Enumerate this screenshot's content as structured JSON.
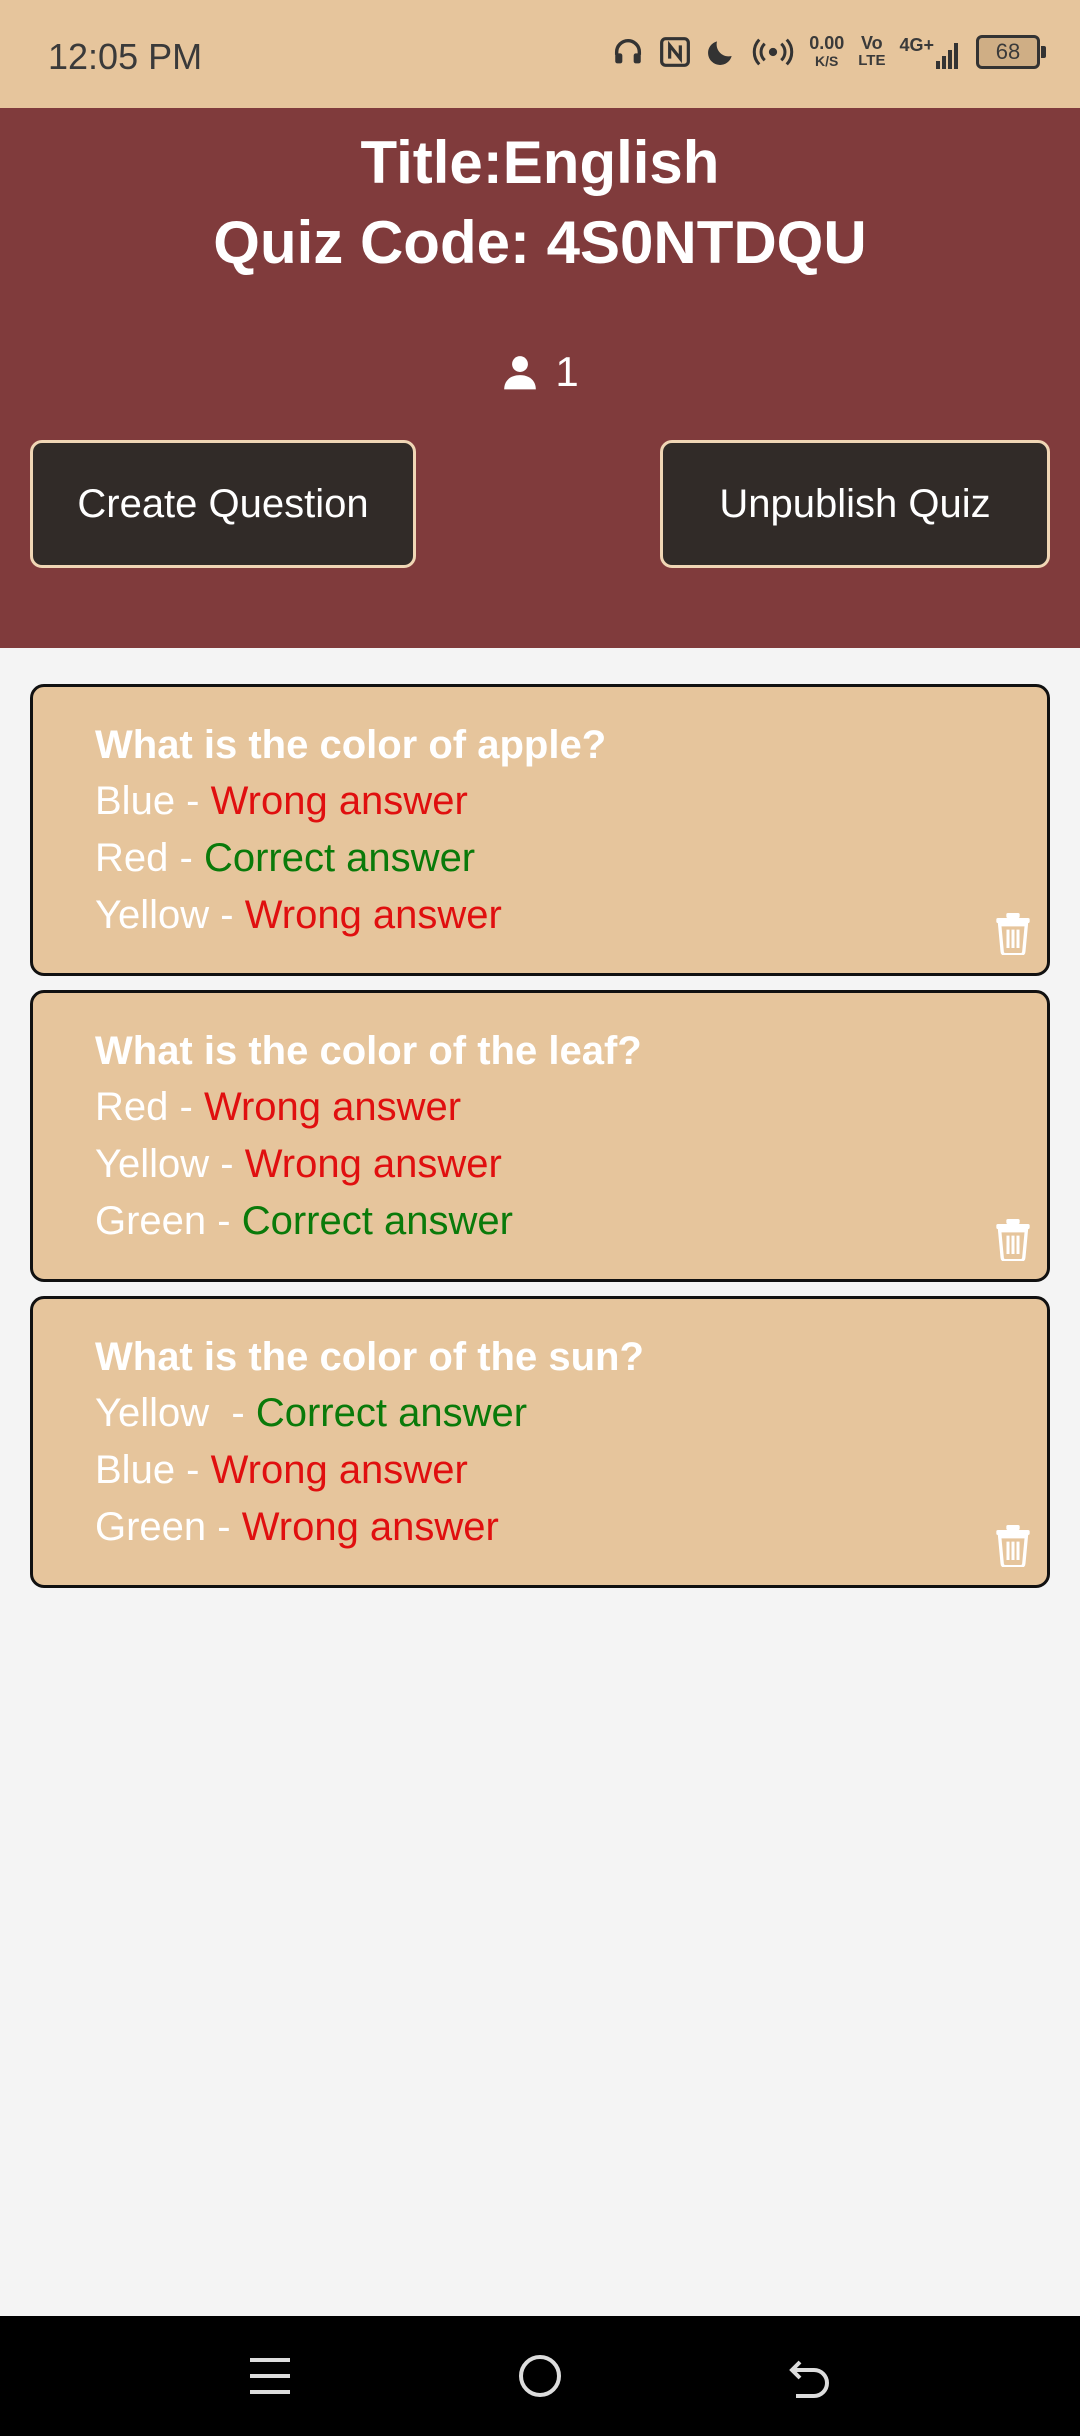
{
  "status": {
    "time": "12:05 PM",
    "net_speed": "0.00",
    "net_unit": "K/S",
    "volte_top": "Vo",
    "volte_bottom": "LTE",
    "network": "4G+",
    "battery": "68"
  },
  "header": {
    "title": "Title:English",
    "quiz_code": "Quiz Code: 4S0NTDQU",
    "participant_count": "1"
  },
  "buttons": {
    "create": "Create Question",
    "unpublish": "Unpublish Quiz"
  },
  "questions": [
    {
      "question": "What is the color of apple?",
      "options": [
        {
          "text": "Blue",
          "sep": " - ",
          "verdict": "Wrong answer",
          "correct": false
        },
        {
          "text": "Red",
          "sep": " - ",
          "verdict": "Correct answer",
          "correct": true
        },
        {
          "text": "Yellow",
          "sep": " - ",
          "verdict": "Wrong answer",
          "correct": false
        }
      ]
    },
    {
      "question": "What is the color of the leaf?",
      "options": [
        {
          "text": "Red",
          "sep": " - ",
          "verdict": "Wrong answer",
          "correct": false
        },
        {
          "text": "Yellow",
          "sep": " - ",
          "verdict": "Wrong answer",
          "correct": false
        },
        {
          "text": "Green",
          "sep": " - ",
          "verdict": "Correct answer",
          "correct": true
        }
      ]
    },
    {
      "question": "What is the color of the sun?",
      "options": [
        {
          "text": "Yellow",
          "sep": "  - ",
          "verdict": "Correct answer",
          "correct": true
        },
        {
          "text": "Blue",
          "sep": " - ",
          "verdict": "Wrong answer",
          "correct": false
        },
        {
          "text": "Green",
          "sep": " - ",
          "verdict": "Wrong answer",
          "correct": false
        }
      ]
    }
  ],
  "colors": {
    "header_bg": "#803b3c",
    "card_bg": "#e6c59c",
    "button_bg": "#312b28",
    "wrong": "#e00f0f",
    "correct": "#0a7a0a"
  }
}
